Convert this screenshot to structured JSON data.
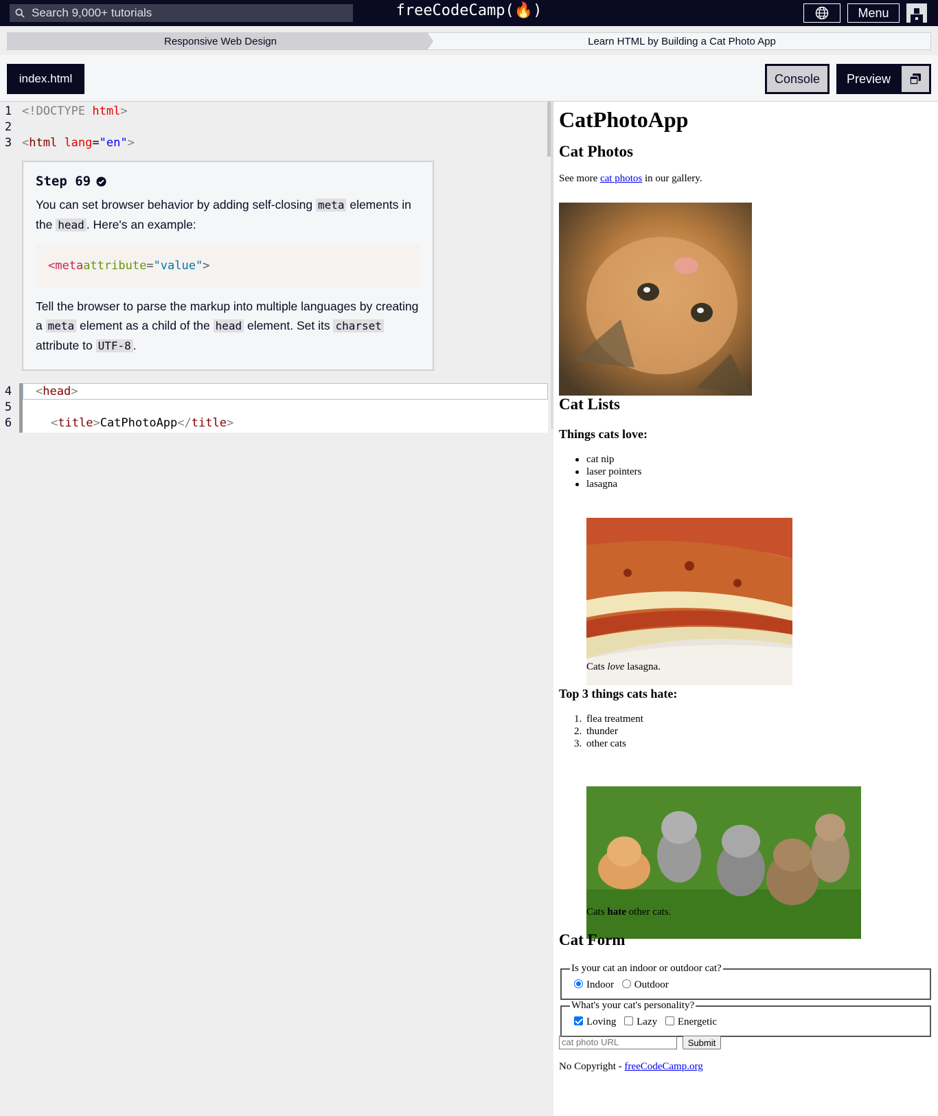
{
  "topnav": {
    "search_placeholder": "Search 9,000+ tutorials",
    "logo": "freeCodeCamp(🔥)",
    "menu_label": "Menu"
  },
  "breadcrumb": {
    "superblock": "Responsive Web Design",
    "block": "Learn HTML by Building a Cat Photo App"
  },
  "toolbar": {
    "file_tab": "index.html",
    "console_label": "Console",
    "preview_label": "Preview"
  },
  "editor": {
    "line_numbers": [
      "1",
      "2",
      "3",
      "4",
      "5",
      "6"
    ],
    "lines": {
      "l1_open": "<!DOCTYPE ",
      "l1_html": "html",
      "l1_close": ">",
      "l3_open": "<",
      "l3_tag": "html",
      "l3_attr": " lang",
      "l3_eq": "=",
      "l3_val": "\"en\"",
      "l3_close": ">",
      "l4_open": "<",
      "l4_tag": "head",
      "l4_close": ">",
      "l6_open": "<",
      "l6_tag": "title",
      "l6_close": ">",
      "l6_text": "CatPhotoApp",
      "l6_end_open": "</",
      "l6_end_tag": "title",
      "l6_end_close": ">"
    }
  },
  "instructions": {
    "title": "Step 69",
    "p1_a": "You can set browser behavior by adding self-closing ",
    "p1_code1": "meta",
    "p1_b": " elements in the ",
    "p1_code2": "head",
    "p1_c": ". Here's an example:",
    "example_tag": "<meta",
    "example_attr": " attribute",
    "example_eq": "=",
    "example_val": "\"value\"",
    "example_close": ">",
    "p2_a": "Tell the browser to parse the markup into multiple languages by creating a ",
    "p2_code1": "meta",
    "p2_b": " element as a child of the ",
    "p2_code2": "head",
    "p2_c": " element. Set its ",
    "p2_code3": "charset",
    "p2_d": " attribute to ",
    "p2_code4": "UTF-8",
    "p2_e": "."
  },
  "preview": {
    "h1": "CatPhotoApp",
    "h2_photos": "Cat Photos",
    "see_more_a": "See more ",
    "see_more_link": "cat photos",
    "see_more_b": " in our gallery.",
    "h2_lists": "Cat Lists",
    "h3_love": "Things cats love:",
    "love_items": [
      "cat nip",
      "laser pointers",
      "lasagna"
    ],
    "caption1_a": "Cats ",
    "caption1_em": "love",
    "caption1_b": " lasagna.",
    "h3_hate": "Top 3 things cats hate:",
    "hate_items": [
      "flea treatment",
      "thunder",
      "other cats"
    ],
    "hate_nums": [
      "1.",
      "2.",
      "3."
    ],
    "caption2_a": "Cats ",
    "caption2_strong": "hate",
    "caption2_b": " other cats.",
    "h2_form": "Cat Form",
    "legend1": "Is your cat an indoor or outdoor cat?",
    "radio_indoor": "Indoor",
    "radio_outdoor": "Outdoor",
    "legend2": "What's your cat's personality?",
    "check_loving": "Loving",
    "check_lazy": "Lazy",
    "check_energetic": "Energetic",
    "url_placeholder": "cat photo URL",
    "submit": "Submit",
    "footer_a": "No Copyright - ",
    "footer_link": "freeCodeCamp.org"
  },
  "colors": {
    "nav_bg": "#0a0a23",
    "accent_gray": "#d0d0d5",
    "link": "#0000ee",
    "checkbox_accent": "#0075ff"
  }
}
